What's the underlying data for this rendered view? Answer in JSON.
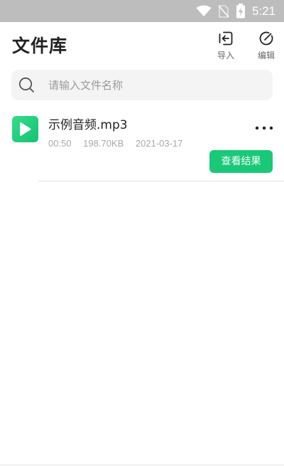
{
  "status_bar": {
    "time": "5:21",
    "icons": [
      "wifi-icon",
      "no-sim-icon",
      "battery-charging-icon"
    ]
  },
  "header": {
    "title": "文件库",
    "actions": [
      {
        "label": "导入",
        "icon": "import-icon"
      },
      {
        "label": "编辑",
        "icon": "edit-icon"
      }
    ]
  },
  "search": {
    "value": "",
    "placeholder": "请输入文件名称",
    "icon": "search-icon"
  },
  "files": [
    {
      "name": "示例音频.mp3",
      "duration": "00:50",
      "size": "198.70KB",
      "date": "2021-03-17",
      "thumb_icon": "play-icon",
      "more_icon": "more-icon",
      "action_label": "查看结果"
    }
  ],
  "colors": {
    "accent": "#19c978",
    "status_bar": "#bdbdbd",
    "search_bg": "#f4f4f4"
  }
}
